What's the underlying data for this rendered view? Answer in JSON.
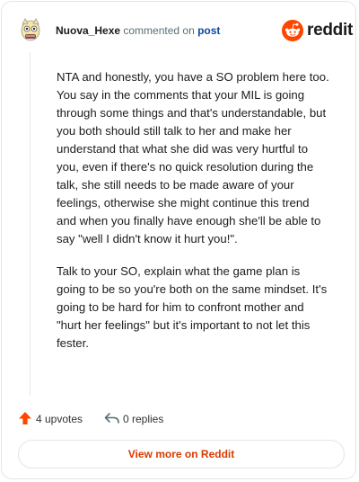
{
  "header": {
    "author": "Nuova_Hexe",
    "action": " commented on ",
    "post_link": "post",
    "brand": "reddit"
  },
  "comment": {
    "paragraphs": [
      "NTA and honestly, you have a SO problem here too. You say in the comments that your MIL is going through some things and that's understandable, but you both should still talk to her and make her understand that what she did was very hurtful to you, even if there's no quick resolution during the talk, she still needs to be made aware of your feelings, otherwise she might continue this trend and when you finally have enough she'll be able to say \"well I didn't know it hurt you!\".",
      "Talk to your SO, explain what the game plan is going to be so you're both on the same mindset. It's going to be hard for him to confront mother and \"hurt her feelings\" but it's important to not let this fester."
    ]
  },
  "footer": {
    "upvotes": "4 upvotes",
    "replies": "0 replies",
    "view_more": "View more on Reddit"
  },
  "colors": {
    "brand": "#ff4500",
    "upvote": "#ff4500",
    "link": "#0a49a4",
    "view_more": "#d93a00"
  },
  "icons": [
    "avatar",
    "reddit-logo-icon",
    "upvote-icon",
    "reply-icon"
  ]
}
